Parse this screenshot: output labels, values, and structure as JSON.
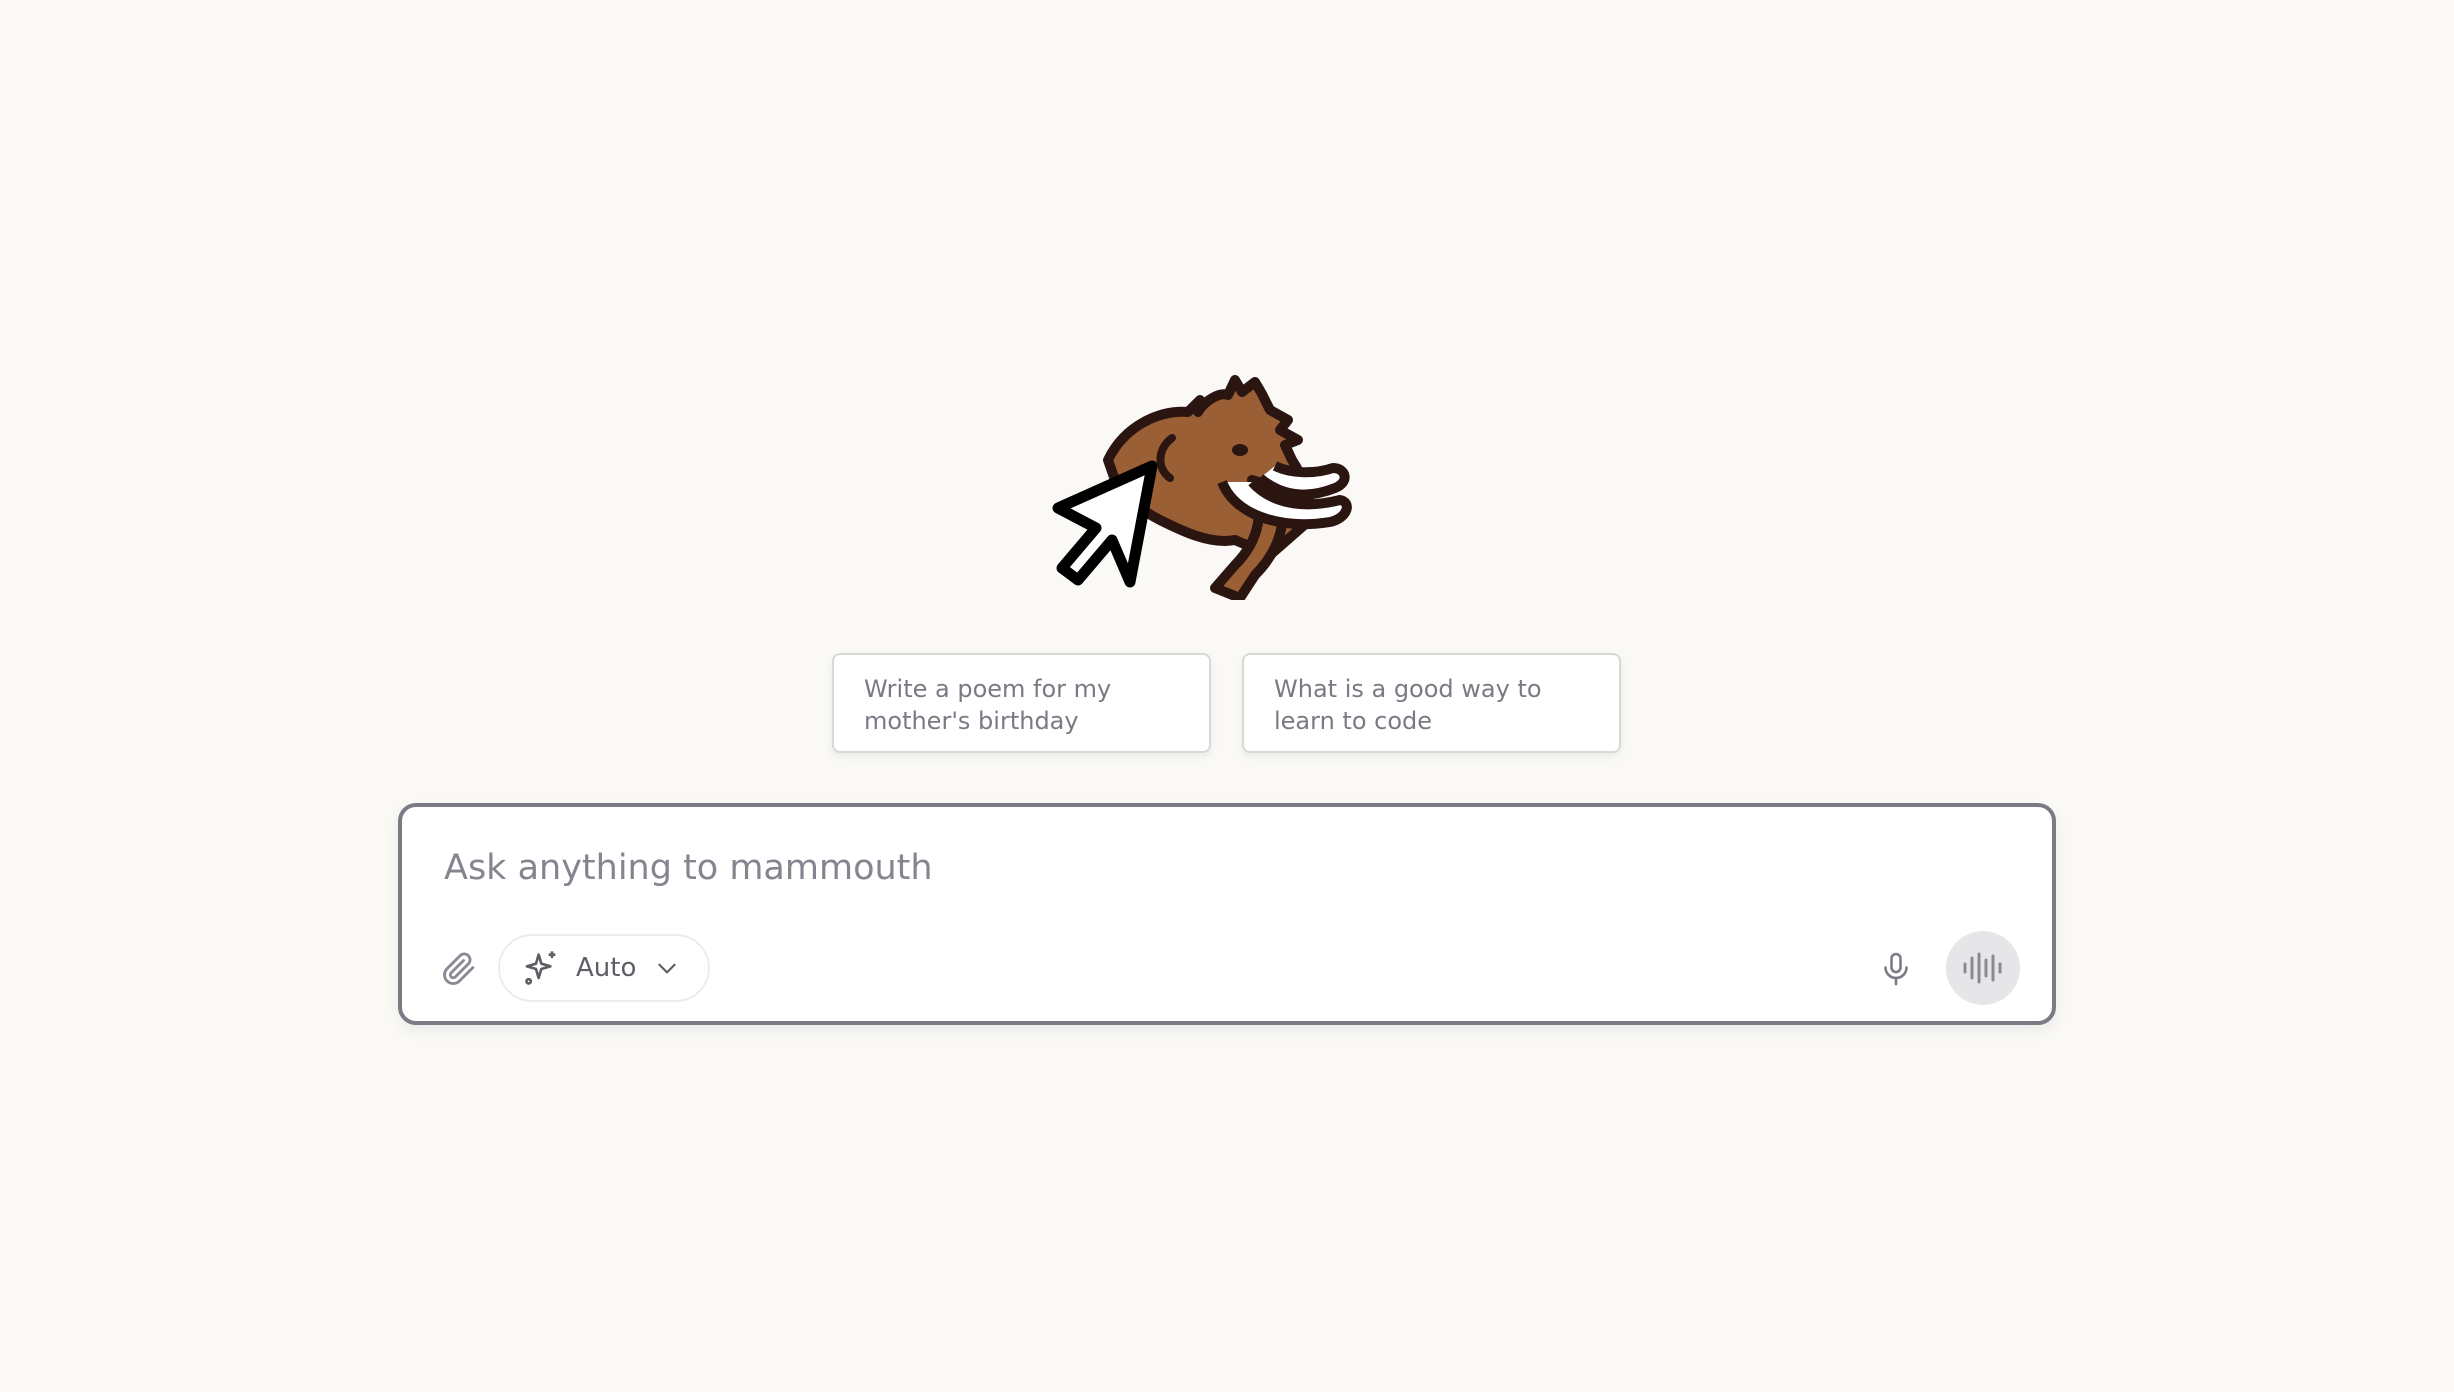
{
  "brand": {
    "logo_icon": "mammoth-with-cursor-logo",
    "colors": {
      "background": "#faf9f6",
      "mammoth_fur": "#9b5f35",
      "outline": "#2a1510",
      "border": "#7b7b86"
    }
  },
  "suggestions": [
    {
      "text": "Write a poem for my mother's birthday"
    },
    {
      "text": "What is a good way to learn to code"
    }
  ],
  "composer": {
    "placeholder": "Ask anything to mammouth",
    "value": "",
    "attach_icon": "paperclip-icon",
    "model_selector": {
      "icon": "sparkles-icon",
      "selected": "Auto",
      "chevron_icon": "chevron-down-icon"
    },
    "mic_icon": "microphone-icon",
    "voice_icon": "waveform-icon"
  }
}
